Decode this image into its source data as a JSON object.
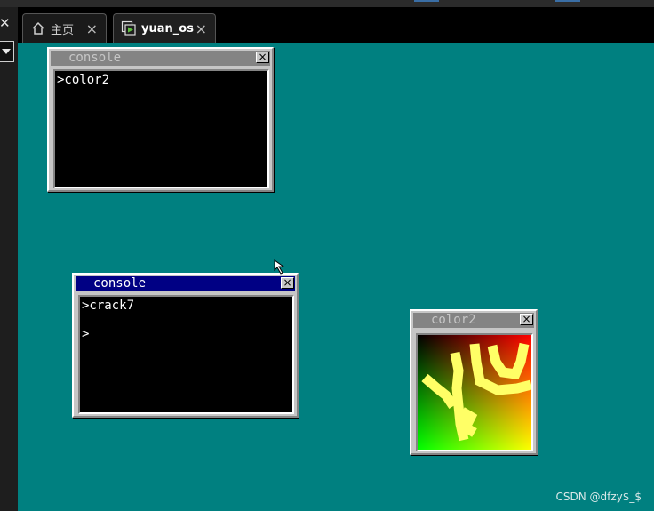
{
  "host": {
    "tabs": [
      {
        "label": "主页",
        "icon": "home-icon"
      },
      {
        "label": "yuan_os",
        "icon": "vm-play-icon"
      }
    ],
    "tab_close_glyph": "×"
  },
  "windows": [
    {
      "title": "console",
      "active": false,
      "lines": [
        ">color2"
      ]
    },
    {
      "title": "console",
      "active": true,
      "lines": [
        ">crack7",
        "",
        ">"
      ]
    },
    {
      "title": "color2",
      "active": false
    }
  ],
  "close_glyph": "×",
  "watermark": "CSDN @dfzy$_$",
  "colors": {
    "desktop": "#008080",
    "active_title": "#000084",
    "inactive_title": "#848484",
    "window_face": "#c6c6c6",
    "scribble": "#ffff66"
  }
}
